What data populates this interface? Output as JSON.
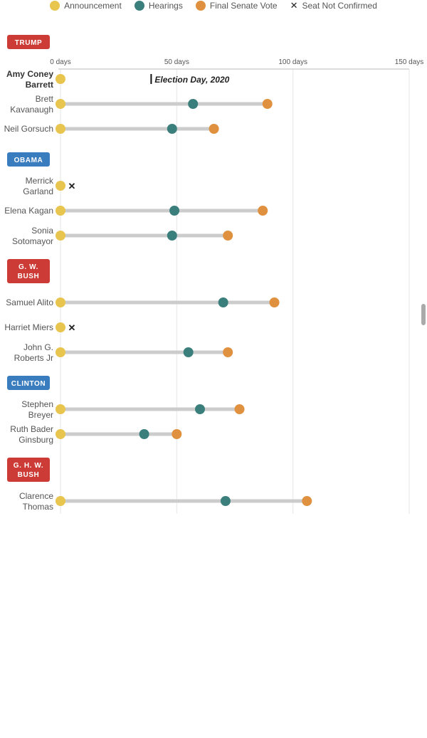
{
  "legend": {
    "announcement": "Announcement",
    "hearings": "Hearings",
    "final_vote": "Final Senate Vote",
    "not_confirmed": "Seat Not Confirmed",
    "not_confirmed_symbol": "✕"
  },
  "colors": {
    "announcement": "#e8c54e",
    "hearings": "#3b7f7c",
    "final_vote": "#e0913f",
    "bar": "#cccccc",
    "republican": "#cc3b35",
    "democrat": "#3a7dbf",
    "grid": "#e6e6e6"
  },
  "chart_data": {
    "type": "dumbbell",
    "x_unit": "days",
    "xlim": [
      0,
      150
    ],
    "ticks": [
      {
        "value": 0,
        "label": "0 days"
      },
      {
        "value": 50,
        "label": "50 days"
      },
      {
        "value": 100,
        "label": "100 days"
      },
      {
        "value": 150,
        "label": "150 days"
      }
    ],
    "annotation": {
      "label": "Election Day, 2020",
      "value": 39
    },
    "groups": [
      {
        "president": "TRUMP",
        "party": "republican",
        "nominees": [
          {
            "name": "Amy Coney Barrett",
            "bold": true,
            "announcement": 0,
            "hearings": null,
            "final_vote": null,
            "not_confirmed": false
          },
          {
            "name": "Brett Kavanaugh",
            "bold": false,
            "announcement": 0,
            "hearings": 57,
            "final_vote": 89,
            "not_confirmed": false
          },
          {
            "name": "Neil Gorsuch",
            "bold": false,
            "announcement": 0,
            "hearings": 48,
            "final_vote": 66,
            "not_confirmed": false
          }
        ]
      },
      {
        "president": "OBAMA",
        "party": "democrat",
        "nominees": [
          {
            "name": "Merrick Garland",
            "bold": false,
            "announcement": 0,
            "hearings": null,
            "final_vote": null,
            "not_confirmed": true
          },
          {
            "name": "Elena Kagan",
            "bold": false,
            "announcement": 0,
            "hearings": 49,
            "final_vote": 87,
            "not_confirmed": false
          },
          {
            "name": "Sonia Sotomayor",
            "bold": false,
            "announcement": 0,
            "hearings": 48,
            "final_vote": 72,
            "not_confirmed": false
          }
        ]
      },
      {
        "president": "G. W. BUSH",
        "party": "republican",
        "nominees": [
          {
            "name": "Samuel Alito",
            "bold": false,
            "announcement": 0,
            "hearings": 70,
            "final_vote": 92,
            "not_confirmed": false
          },
          {
            "name": "Harriet Miers",
            "bold": false,
            "announcement": 0,
            "hearings": null,
            "final_vote": null,
            "not_confirmed": true
          },
          {
            "name": "John G. Roberts Jr",
            "bold": false,
            "announcement": 0,
            "hearings": 55,
            "final_vote": 72,
            "not_confirmed": false
          }
        ]
      },
      {
        "president": "CLINTON",
        "party": "democrat",
        "nominees": [
          {
            "name": "Stephen Breyer",
            "bold": false,
            "announcement": 0,
            "hearings": 60,
            "final_vote": 77,
            "not_confirmed": false
          },
          {
            "name": "Ruth Bader Ginsburg",
            "bold": false,
            "announcement": 0,
            "hearings": 36,
            "final_vote": 50,
            "not_confirmed": false
          }
        ]
      },
      {
        "president": "G. H. W. BUSH",
        "party": "republican",
        "nominees": [
          {
            "name": "Clarence Thomas",
            "bold": false,
            "announcement": 0,
            "hearings": 71,
            "final_vote": 106,
            "not_confirmed": false
          }
        ]
      }
    ]
  }
}
